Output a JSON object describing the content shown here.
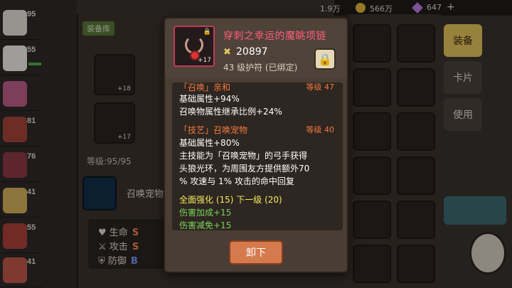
{
  "party": [
    {
      "level": "95"
    },
    {
      "level": "55"
    },
    {
      "level": "81"
    },
    {
      "level": "76"
    },
    {
      "level": "41"
    },
    {
      "level": "55"
    },
    {
      "level": "41"
    }
  ],
  "inventory": {
    "tag_label": "装备库",
    "slot1_plus": "+18",
    "slot2_plus": "+17",
    "level_label": "等级:95/95",
    "summon_label": "召唤宠物"
  },
  "stats": [
    {
      "label": "生命",
      "grade": "S"
    },
    {
      "label": "攻击",
      "grade": "S"
    },
    {
      "label": "防御",
      "grade": "B"
    }
  ],
  "top_bar": {
    "currency1": "1.9万",
    "currency2": "566万",
    "currency3": "647"
  },
  "side_tabs": {
    "equip": "装备",
    "cards": "卡片",
    "use": "使用"
  },
  "modal": {
    "item_name": "穿刺之幸运的魔眺项链",
    "power": "20897",
    "bind_text": "43 级护符 (已绑定)",
    "plus_level": "+17",
    "sections": [
      {
        "title": "「召唤」亲和",
        "level": "等级 47"
      },
      {
        "title": "「技艺」召唤宠物",
        "level": "等级 40"
      }
    ],
    "lines1": [
      "基础属性+94%",
      "召唤物属性继承比例+24%"
    ],
    "lines2": [
      "基础属性+80%",
      "主技能为「召唤宠物」的弓手获得",
      "头狼光环，为周围友方提供额外70",
      "% 攻速与 1% 攻击的命中回复"
    ],
    "enhance": "全面强化 (15) 下一级 (20)",
    "green_lines": [
      "伤害加成+15",
      "伤害减免+15"
    ],
    "unequip": "卸下"
  },
  "colors": {
    "item_name": "#ff5f7c",
    "section_title": "#f2793f",
    "enhance": "#f4ec5e",
    "green": "#7ed35a",
    "button": "#d57a4d"
  }
}
